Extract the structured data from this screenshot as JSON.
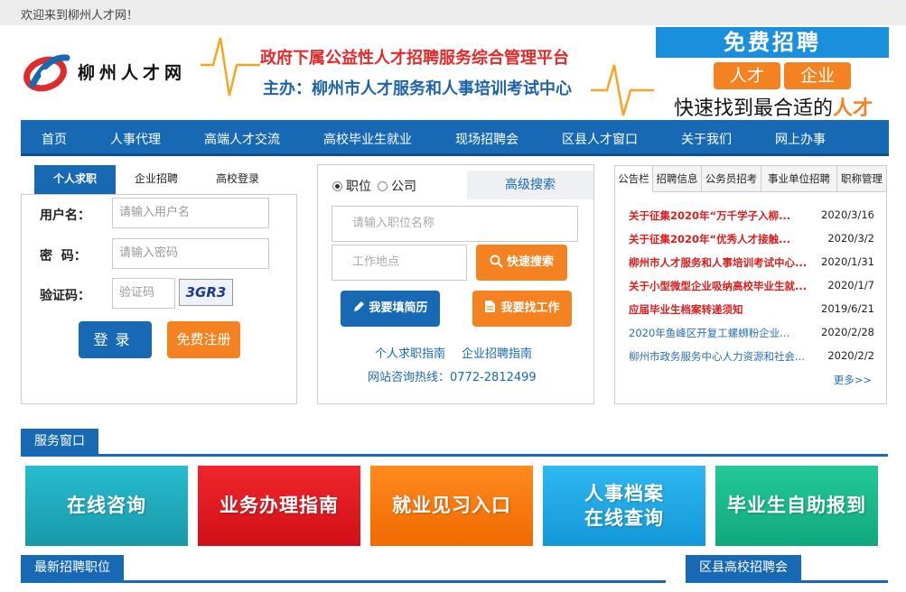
{
  "topbar": {
    "welcome": "欢迎来到柳州人才网！"
  },
  "header": {
    "logo_text": "柳州人才网",
    "slogan_line1": "政府下属公益性人才招聘服务综合管理平台",
    "slogan_line2": "主办：柳州市人才服务和人事培训考试中心",
    "ad": {
      "title": "免费招聘",
      "pill_left": "人才",
      "amp": "&",
      "pill_right": "企业",
      "sub_prefix": "快速找到最合适的",
      "sub_highlight": "人才"
    }
  },
  "nav": {
    "items": [
      "首页",
      "人事代理",
      "高端人才交流",
      "高校毕业生就业",
      "现场招聘会",
      "区县人才窗口",
      "关于我们",
      "网上办事"
    ]
  },
  "login": {
    "tabs": [
      "个人求职",
      "企业招聘",
      "高校登录"
    ],
    "username_label": "用户名：",
    "username_placeholder": "请输入用户名",
    "password_label": "密  码：",
    "password_placeholder": "请输入密码",
    "captcha_label": "验证码：",
    "captcha_placeholder": "验证码",
    "captcha_image_text": "3GR3",
    "login_button": "登录",
    "register_button": "免费注册"
  },
  "search": {
    "radio_position": "职位",
    "radio_company": "公司",
    "advanced": "高级搜索",
    "keyword_placeholder": "请输入职位名称",
    "location_placeholder": "工作地点",
    "quick_search": "快速搜索",
    "fill_resume": "我要填简历",
    "find_job": "我要找工作",
    "guide_personal": "个人求职指南",
    "guide_company": "企业招聘指南",
    "hotline": "网站咨询热线：0772-2812499"
  },
  "notice": {
    "tabs": [
      "公告栏",
      "招聘信息",
      "公务员招考",
      "事业单位招聘",
      "职称管理"
    ],
    "items": [
      {
        "title": "关于征集2020年“万千学子入柳...",
        "date": "2020/3/16"
      },
      {
        "title": "关于征集2020年“优秀人才接触...",
        "date": "2020/3/2"
      },
      {
        "title": "柳州市人才服务和人事培训考试中心...",
        "date": "2020/1/31"
      },
      {
        "title": "关于小型微型企业吸纳高校毕业生就...",
        "date": "2020/1/7"
      },
      {
        "title": "应届毕业生档案转递须知",
        "date": "2019/6/21"
      },
      {
        "title": "2020年鱼峰区开复工螺蛳粉企业...",
        "date": "2020/2/28"
      },
      {
        "title": "柳州市政务服务中心人力资源和社会...",
        "date": "2020/2/2"
      }
    ],
    "more": "更多>>"
  },
  "service": {
    "title": "服务窗口",
    "tiles": [
      "在线咨询",
      "业务办理指南",
      "就业见习入口",
      "人事档案",
      "在线查询",
      "毕业生自助报到"
    ]
  },
  "latest_jobs": {
    "title": "最新招聘职位"
  },
  "county_fair": {
    "title": "区县高校招聘会"
  },
  "colors": {
    "primary_blue": "#1769b3",
    "accent_orange": "#f58220",
    "notice_red": "#d81e1e"
  }
}
